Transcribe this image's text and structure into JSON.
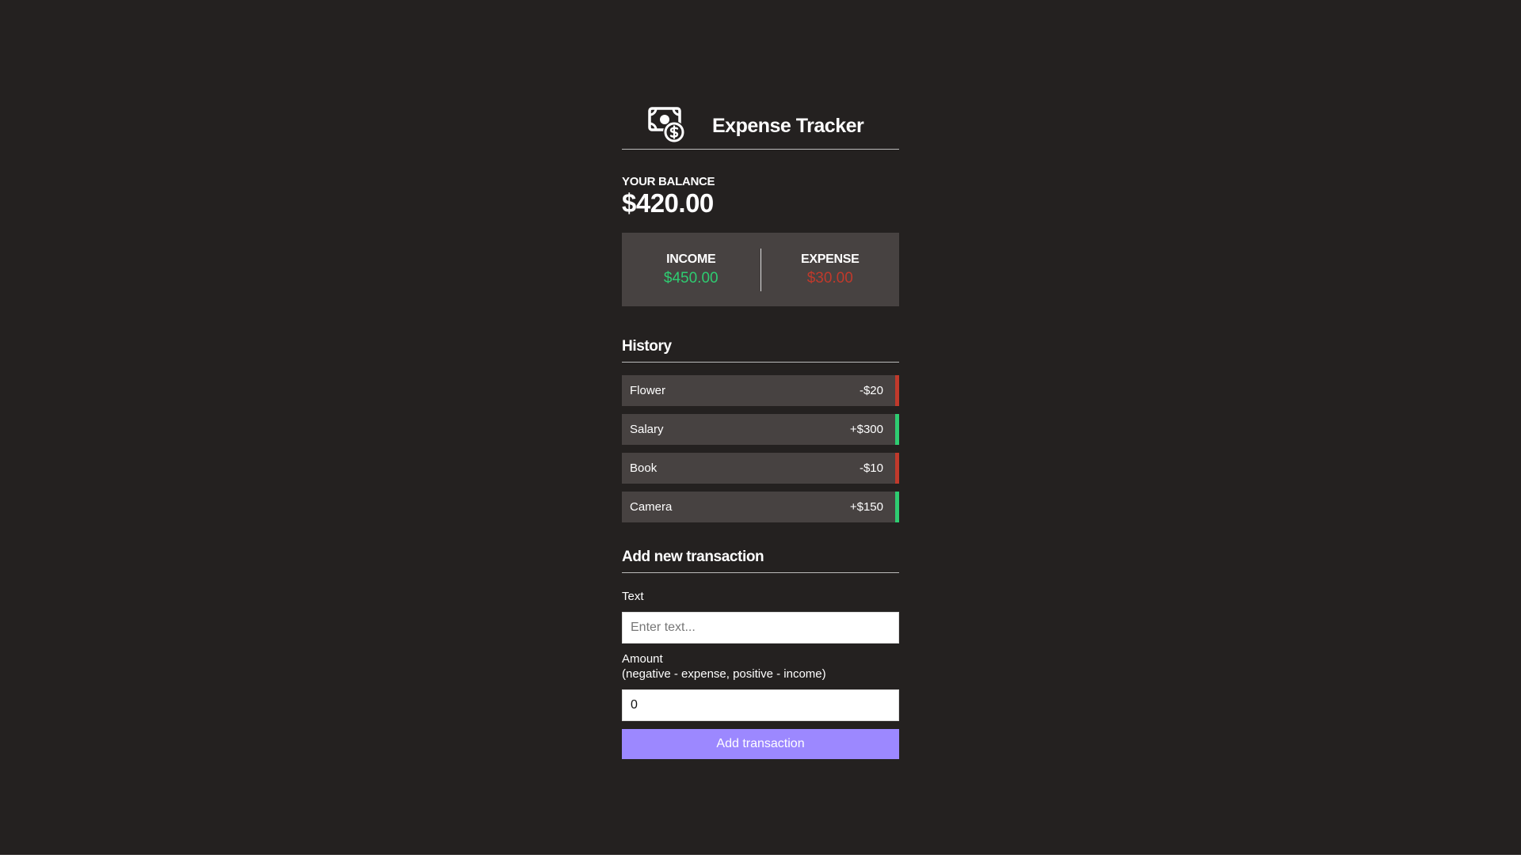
{
  "app": {
    "title": "Expense Tracker",
    "logo_icon": "money-bill-dollar-icon"
  },
  "balance": {
    "label": "YOUR BALANCE",
    "value": "$420.00"
  },
  "summary": {
    "income_label": "INCOME",
    "income_value": "$450.00",
    "expense_label": "EXPENSE",
    "expense_value": "$30.00"
  },
  "history": {
    "title": "History",
    "items": [
      {
        "text": "Flower",
        "amount": "-$20",
        "type": "minus"
      },
      {
        "text": "Salary",
        "amount": "+$300",
        "type": "plus"
      },
      {
        "text": "Book",
        "amount": "-$10",
        "type": "minus"
      },
      {
        "text": "Camera",
        "amount": "+$150",
        "type": "plus"
      }
    ]
  },
  "form": {
    "title": "Add new transaction",
    "text_label": "Text",
    "text_placeholder": "Enter text...",
    "text_value": "",
    "amount_label": "Amount",
    "amount_hint": "(negative - expense, positive - income)",
    "amount_value": "0",
    "submit_label": "Add transaction"
  },
  "colors": {
    "background": "#242120",
    "panel": "#474241",
    "income": "#2ecc71",
    "expense": "#c0392b",
    "accent": "#9c88ff"
  }
}
